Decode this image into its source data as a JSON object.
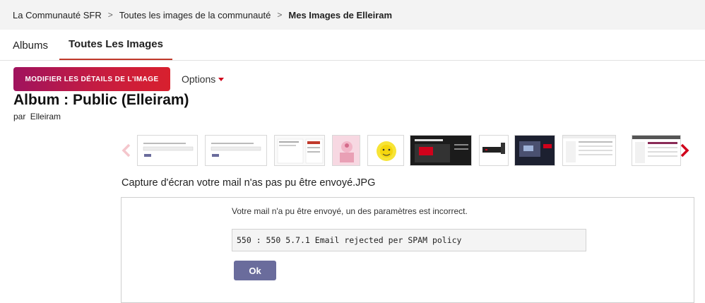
{
  "breadcrumb": {
    "items": [
      "La Communauté SFR",
      "Toutes les images de la communauté"
    ],
    "current": "Mes Images de Elleiram"
  },
  "tabs": [
    {
      "label": "Albums",
      "active": false
    },
    {
      "label": "Toutes Les Images",
      "active": true
    }
  ],
  "toolbar": {
    "modify_label": "MODIFIER LES DÉTAILS DE L'IMAGE",
    "options_label": "Options"
  },
  "album": {
    "title": "Album : Public (Elleiram)",
    "by_label": "par",
    "author": "Elleiram"
  },
  "carousel": {
    "prev_icon": "chevron-left-icon",
    "next_icon": "chevron-right-icon",
    "thumbnails": [
      "thumb-1",
      "thumb-2",
      "thumb-3",
      "thumb-4",
      "thumb-5",
      "thumb-6",
      "thumb-7",
      "thumb-8",
      "thumb-9",
      "thumb-10"
    ]
  },
  "image": {
    "caption": "Capture d'écran votre mail n'as pas pu être envoyé.JPG",
    "message": "Votre mail n'a pu être envoyé, un des paramètres est incorrect.",
    "code": "550 : 550 5.7.1 Email rejected per SPAM policy",
    "ok_label": "Ok"
  },
  "colors": {
    "accent": "#c91d3e",
    "arrow_prev": "#f4c6cc",
    "arrow_next": "#d0021b",
    "ok_button": "#6a6c9c"
  }
}
